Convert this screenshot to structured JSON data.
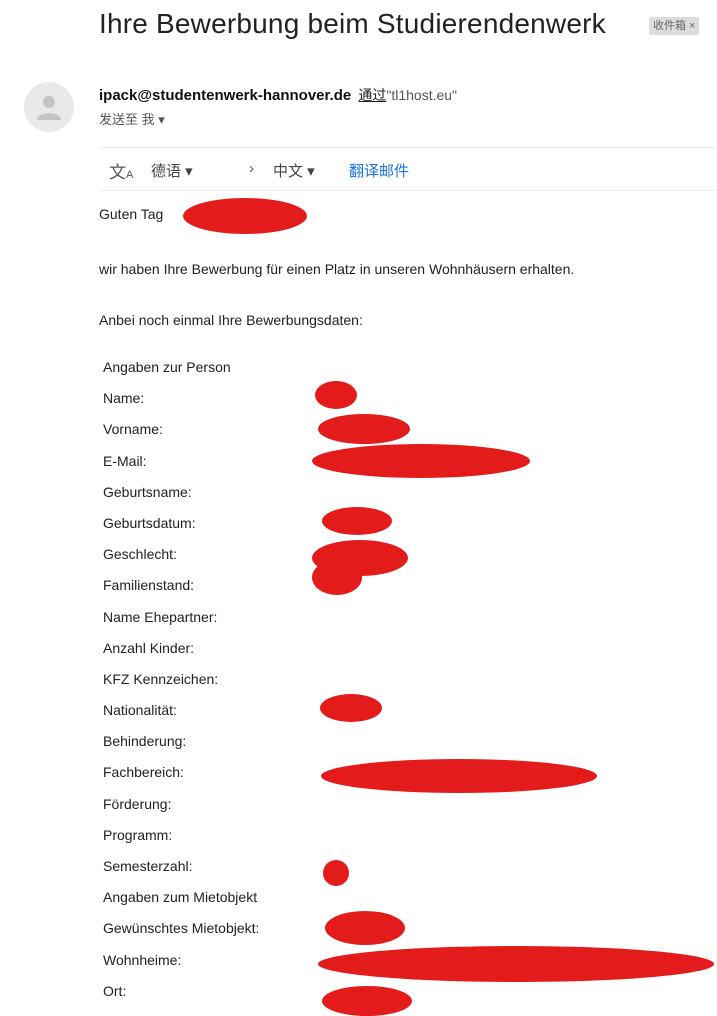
{
  "email": {
    "subject": "Ihre Bewerbung beim Studierendenwerk",
    "inbox_label": "收件箱 ×",
    "sender": "ipack@studentenwerk-hannover.de",
    "via_label": "通过",
    "via_domain": "\"tl1host.eu\"",
    "recipient_label": "发送至 我 ▾"
  },
  "translate_bar": {
    "from_lang": "德语 ▾",
    "arrow": "›",
    "to_lang": "中文 ▾",
    "translate_label": "翻译邮件"
  },
  "body": {
    "greeting": "Guten Tag",
    "line1": "wir haben Ihre Bewerbung für einen Platz in unseren Wohnhäusern erhalten.",
    "line2": "Anbei noch einmal Ihre Bewerbungsdaten:"
  },
  "fields": [
    "Angaben zur Person",
    "Name:",
    "Vorname:",
    "E-Mail:",
    "Geburtsname:",
    "Geburtsdatum:",
    "Geschlecht:",
    "Familienstand:",
    "Name Ehepartner:",
    "Anzahl Kinder:",
    "KFZ Kennzeichen:",
    "Nationalität:",
    "Behinderung:",
    "Fachbereich:",
    "Förderung:",
    "Programm:",
    "Semesterzahl:",
    "Angaben zum Mietobjekt",
    "Gewünschtes Mietobjekt:",
    "Wohnheime:",
    "Ort:"
  ],
  "colors": {
    "redaction": "#e31b1b",
    "link": "#1a73e8"
  }
}
